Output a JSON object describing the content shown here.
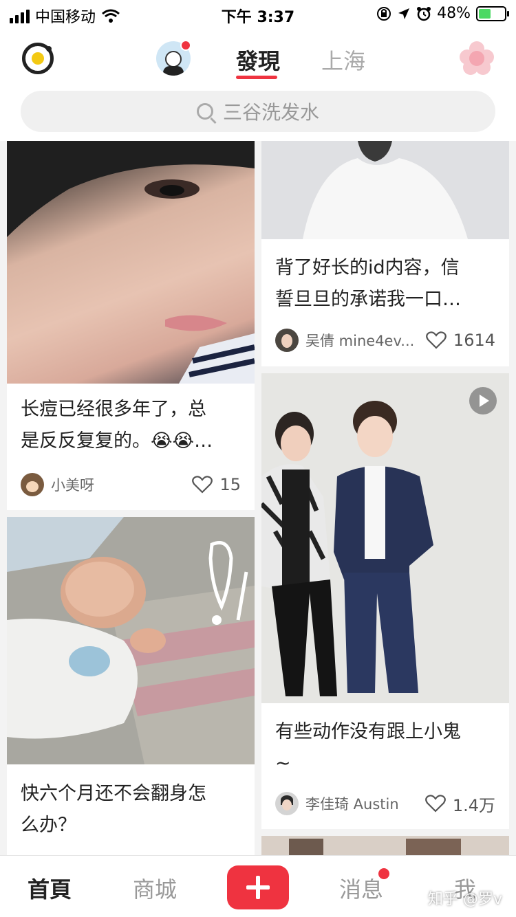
{
  "status_bar": {
    "carrier": "中国移动",
    "time": "下午 3:37",
    "battery": "48%",
    "battery_level": 0.48
  },
  "header": {
    "tab_active": "發現",
    "tab_city": "上海",
    "search_placeholder": "三谷洗发水"
  },
  "feed": {
    "left": [
      {
        "title_line1": "长痘已经很多年了，总",
        "title_line2": "是反反复复的。😭😭…",
        "author": "小美呀",
        "likes": "15"
      },
      {
        "title_line1": "快六个月还不会翻身怎",
        "title_line2": "么办？"
      }
    ],
    "right": [
      {
        "title_line1": "背了好长的id内容，信",
        "title_line2": "誓旦旦的承诺我一口…",
        "author": "吴倩 mine4ev...",
        "likes": "1614"
      },
      {
        "title_line1": "有些动作没有跟上小鬼",
        "title_line2": "~",
        "author": "李佳琦 Austin",
        "likes": "1.4万"
      }
    ]
  },
  "bottom_nav": {
    "home": "首頁",
    "mall": "商城",
    "messages": "消息",
    "me": "我"
  },
  "watermark": "知乎 @罗v"
}
